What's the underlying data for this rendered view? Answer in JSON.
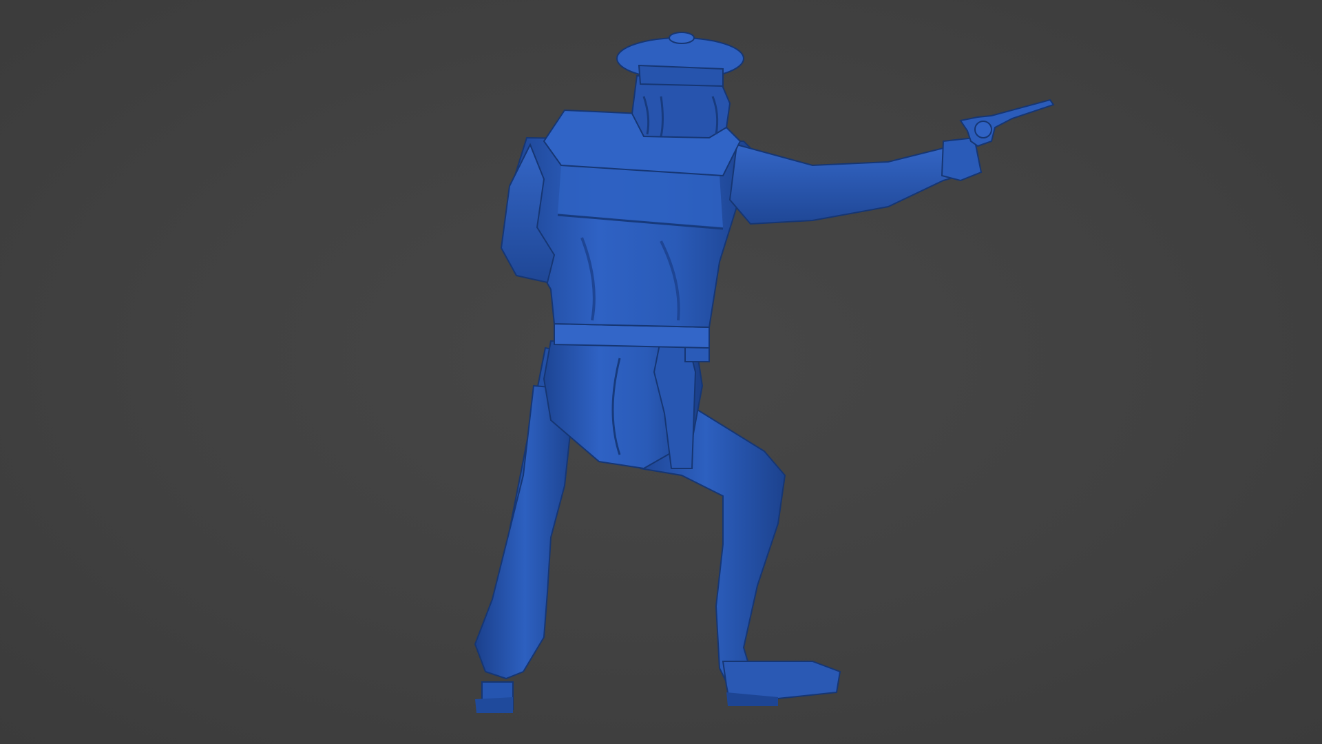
{
  "scene": {
    "background_color": "#404040",
    "model_color": "#2a5bb8",
    "model_shadow_color": "#1a3d85",
    "model_highlight_color": "#4a7ad6",
    "subject_icon": "sculpted-figure-gunman-back-view"
  }
}
